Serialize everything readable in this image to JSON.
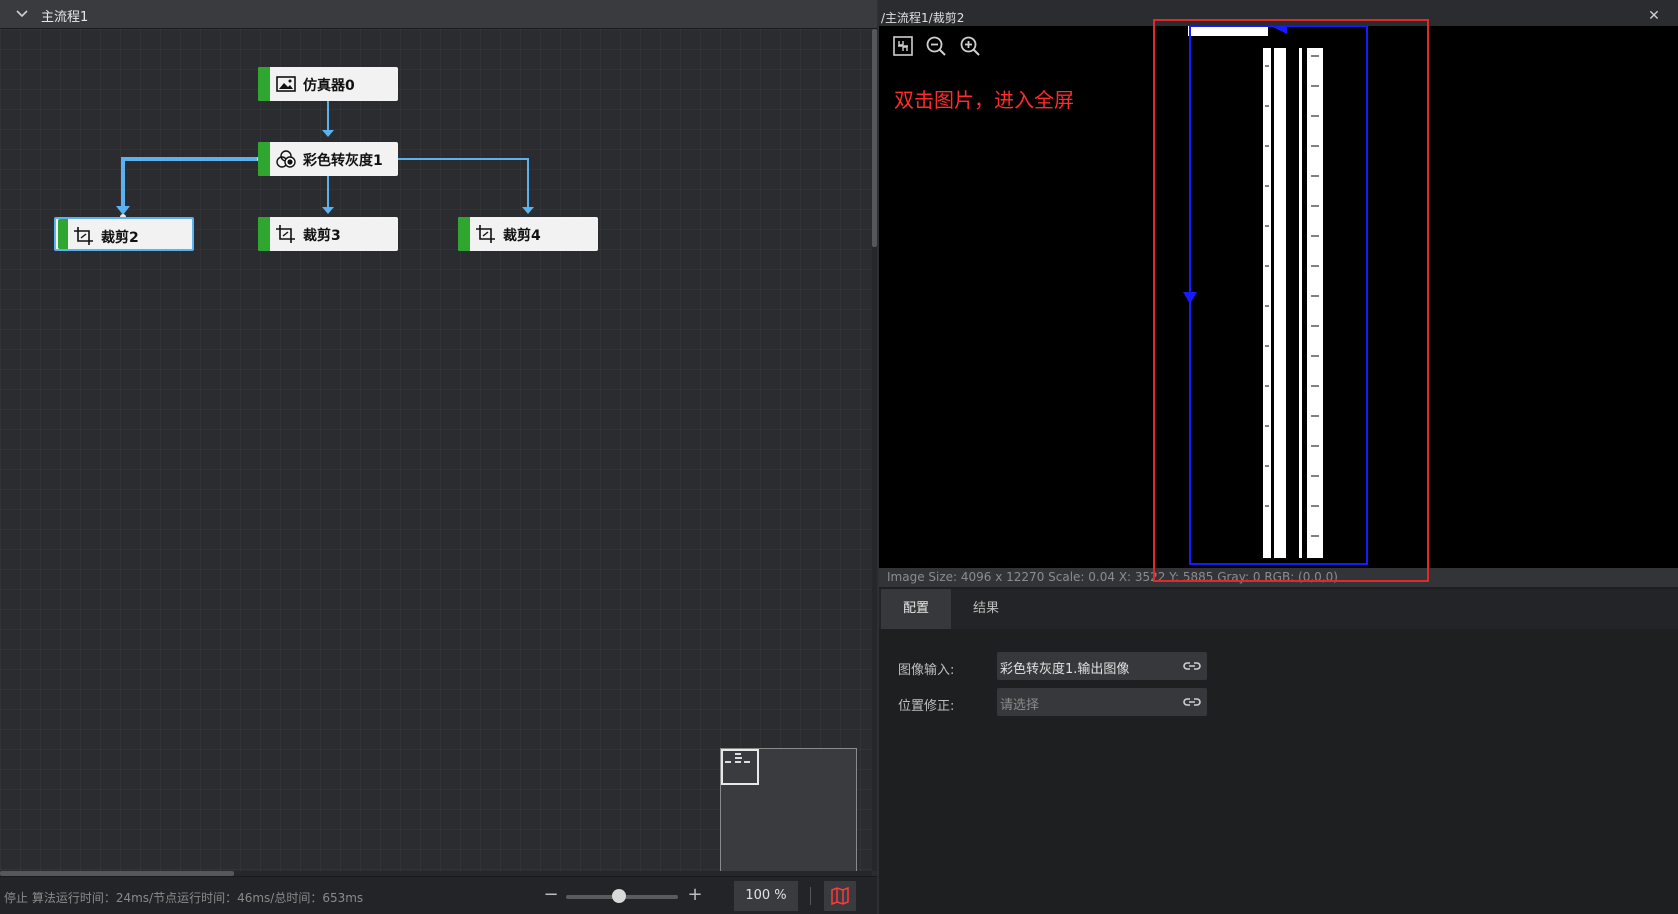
{
  "left_panel": {
    "header_title": "主流程1",
    "nodes": [
      {
        "label": "仿真器0",
        "icon": "image-icon"
      },
      {
        "label": "彩色转灰度1",
        "icon": "color-channels-icon"
      },
      {
        "label": "裁剪2",
        "icon": "crop-icon",
        "selected": true
      },
      {
        "label": "裁剪3",
        "icon": "crop-icon"
      },
      {
        "label": "裁剪4",
        "icon": "crop-icon"
      }
    ],
    "status_text": "停止 算法运行时间：24ms/节点运行时间：46ms/总时间：653ms",
    "zoom": {
      "value_label": "100 %",
      "minus_icon": "minus-icon",
      "plus_icon": "plus-icon",
      "level_percent": 100
    },
    "map_toggle_icon": "book-map-icon"
  },
  "right_panel": {
    "path": "/主流程1/裁剪2",
    "close_icon": "close-icon",
    "toolbar_icons": [
      "fit-view-icon",
      "zoom-out-icon",
      "zoom-in-icon"
    ],
    "hint": "双击图片，进入全屏",
    "image_info": "Image Size: 4096 x 12270 Scale: 0.04 X: 3522 Y: 5885 Gray: 0 RGB: (0,0,0)",
    "tabs": [
      {
        "label": "配置",
        "active": true
      },
      {
        "label": "结果",
        "active": false
      }
    ],
    "fields": [
      {
        "label": "图像输入:",
        "value": "彩色转灰度1.输出图像",
        "placeholder": ""
      },
      {
        "label": "位置修正:",
        "value": "",
        "placeholder": "请选择"
      }
    ]
  },
  "colors": {
    "node_accent": "#2fa62f",
    "connector": "#5ab3f0",
    "annotation_red": "#e02a2a",
    "roi_blue": "#1a1aff"
  }
}
